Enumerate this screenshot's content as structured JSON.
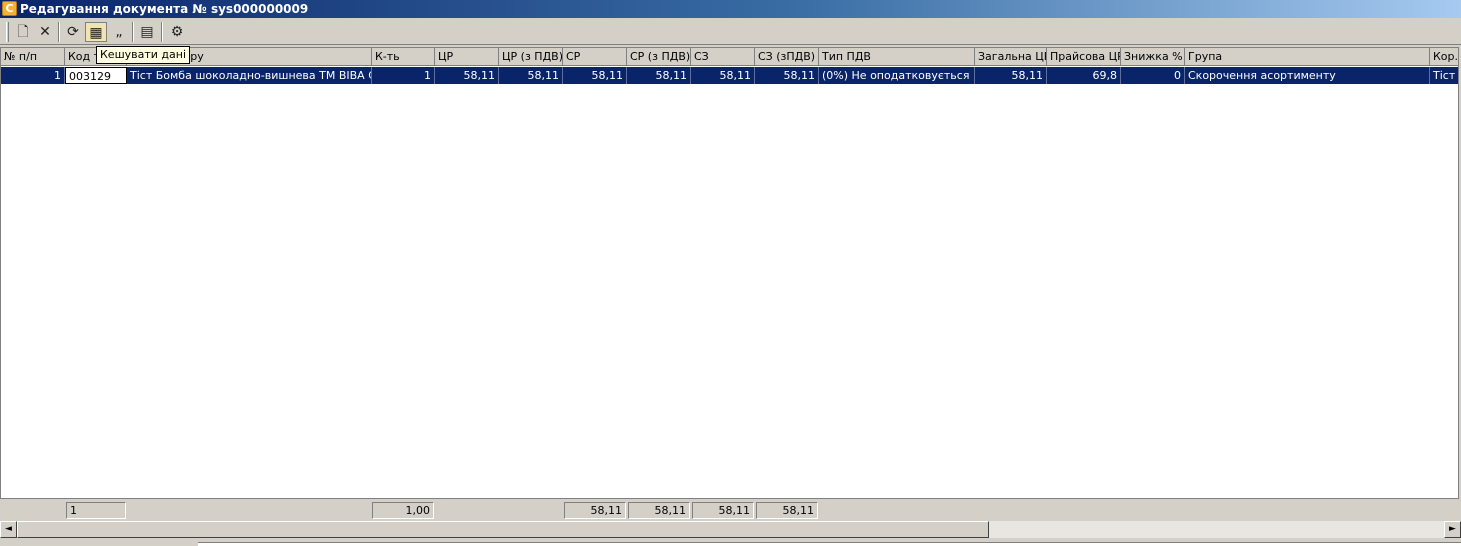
{
  "window": {
    "title": "Редагування документа № sys000000009"
  },
  "toolbar": {
    "buttons": [
      {
        "icon": "new-document-icon",
        "glyph": "🗋"
      },
      {
        "icon": "delete-icon",
        "glyph": "✕"
      },
      {
        "icon": "refresh-link-icon",
        "glyph": "⟳"
      },
      {
        "icon": "cache-data-icon",
        "glyph": "▦"
      },
      {
        "icon": "quotes-icon",
        "glyph": "„"
      },
      {
        "icon": "calculator-icon",
        "glyph": "▤"
      },
      {
        "icon": "settings-gear-icon",
        "glyph": "⚙"
      }
    ],
    "tooltip": "Кешувати дані"
  },
  "grid": {
    "columns": [
      "№ п/п",
      "Код т",
      "вару",
      "К-ть",
      "ЦР",
      "ЦР (з ПДВ)",
      "СР",
      "СР (з ПДВ)",
      "СЗ",
      "СЗ (зПДВ)",
      "Тип ПДВ",
      "Загальна ЦР",
      "Прайсова ЦР",
      "Знижка %",
      "Група",
      "Кор."
    ],
    "row": {
      "num": "1",
      "code": "003129",
      "name": "Тіст  Бомба шоколадно-вишнева ТМ BIBA Смак",
      "qty": "1",
      "cr": "58,11",
      "cr_vat": "58,11",
      "sr": "58,11",
      "sr_vat": "58,11",
      "sz": "58,11",
      "sz_vat": "58,11",
      "vat_type": "(0%) Не оподатковується",
      "total_cr": "58,11",
      "price_cr": "69,8",
      "discount": "0",
      "group": "Скорочення асортименту",
      "kor": "Тіст"
    }
  },
  "footer": {
    "count": "1",
    "qty_total": "1,00",
    "sr_total": "58,11",
    "sr_vat_total": "58,11",
    "sz_total": "58,11",
    "sz_vat_total": "58,11"
  },
  "scrollbar": {
    "left_arrow": "◄",
    "right_arrow": "►"
  }
}
